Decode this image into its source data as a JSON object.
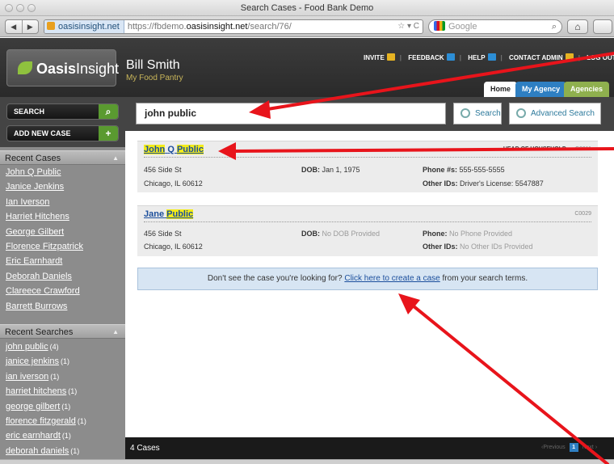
{
  "window": {
    "title": "Search Cases - Food Bank Demo"
  },
  "browser": {
    "url_domain": "oasisinsight.net",
    "url_prefix": "https://fbdemo.",
    "url_host_bold": "oasisinsight.net",
    "url_path": "/search/76/",
    "url_controls": "☆ ▾ C",
    "search_engine_placeholder": "Google"
  },
  "header": {
    "logo_bold": "Oasis",
    "logo_light": "Insight",
    "user_name": "Bill Smith",
    "pantry": "My Food Pantry",
    "nav": [
      "INVITE",
      "FEEDBACK",
      "HELP",
      "CONTACT ADMIN",
      "LOG OUT"
    ],
    "tabs": [
      "Home",
      "My Agency",
      "Agencies"
    ]
  },
  "sidebar": {
    "search_label": "SEARCH",
    "add_case_label": "ADD NEW CASE",
    "recent_cases_title": "Recent Cases",
    "recent_cases": [
      "John Q Public",
      "Janice Jenkins",
      "Ian Iverson",
      "Harriet Hitchens",
      "George Gilbert",
      "Florence Fitzpatrick",
      "Eric Earnhardt",
      "Deborah Daniels",
      "Clareece Crawford",
      "Barrett Burrows"
    ],
    "recent_searches_title": "Recent Searches",
    "recent_searches": [
      {
        "term": "john public",
        "count": "(4)"
      },
      {
        "term": "janice jenkins",
        "count": "(1)"
      },
      {
        "term": "ian iverson",
        "count": "(1)"
      },
      {
        "term": "harriet hitchens",
        "count": "(1)"
      },
      {
        "term": "george gilbert",
        "count": "(1)"
      },
      {
        "term": "florence fitzgerald",
        "count": "(1)"
      },
      {
        "term": "eric earnhardt",
        "count": "(1)"
      },
      {
        "term": "deborah daniels",
        "count": "(1)"
      }
    ]
  },
  "search": {
    "query": "john public",
    "search_button": "Search",
    "advanced_button": "Advanced Search"
  },
  "results": [
    {
      "name_first": "John",
      "name_middle": "Q",
      "name_last": "Public",
      "role": "HEAD OF HOUSEHOLD",
      "role_sep": "—",
      "case_id": "C0011",
      "street": "456 Side St",
      "city": "Chicago, IL 60612",
      "dob_label": "DOB:",
      "dob": "Jan 1, 1975",
      "phone_label": "Phone #s:",
      "phone": "555-555-5555",
      "other_label": "Other IDs:",
      "other": "Driver's License: 5547887"
    },
    {
      "name_first": "Jane",
      "name_last": "Public",
      "case_id": "C0029",
      "street": "456 Side St",
      "city": "Chicago, IL 60612",
      "dob_label": "DOB:",
      "dob": "No DOB Provided",
      "phone_label": "Phone:",
      "phone": "No Phone Provided",
      "other_label": "Other IDs:",
      "other": "No Other IDs Provided"
    }
  ],
  "not_found": {
    "prefix": "Don't see the case you're looking for?",
    "link": "Click here to create a case",
    "suffix": "from your search terms."
  },
  "footer": {
    "count": "4 Cases",
    "prev": "‹Previous",
    "page": "1",
    "next": "Next ›"
  },
  "colors": {
    "annotation_arrow": "#e8141b",
    "highlight": "#f3ec19",
    "link": "#1b4e9c"
  }
}
